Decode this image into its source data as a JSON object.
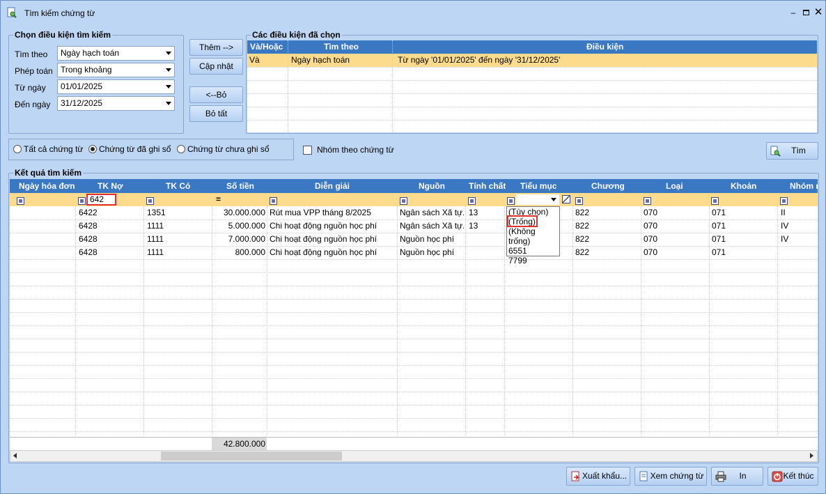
{
  "window": {
    "title": "Tìm kiếm chứng từ"
  },
  "conditions": {
    "legend": "Chọn điều kiện tìm kiếm",
    "search_by_label": "Tìm theo",
    "search_by_value": "Ngày hạch toán",
    "operator_label": "Phép toán",
    "operator_value": "Trong khoảng",
    "from_label": "Từ ngày",
    "from_value": "01/01/2025",
    "to_label": "Đến ngày",
    "to_value": "31/12/2025"
  },
  "buttons": {
    "add": "Thêm -->",
    "update": "Cập nhật",
    "remove": "<--Bỏ",
    "remove_all": "Bỏ tất",
    "search": "Tìm",
    "export": "Xuất khẩu...",
    "view": "Xem chứng từ",
    "print": "In",
    "close": "Kết thúc"
  },
  "selected": {
    "legend": "Các điều kiện đã chọn",
    "headers": [
      "Và/Hoặc",
      "Tìm theo",
      "Điều kiện"
    ],
    "row": [
      "Và",
      "Ngày hạch toán",
      "Từ ngày '01/01/2025' đến ngày '31/12/2025'"
    ]
  },
  "filters": {
    "all": "Tất cả chứng từ",
    "posted": "Chứng từ đã ghi sổ",
    "unposted": "Chứng từ chưa ghi sổ",
    "group_by": "Nhóm theo chứng từ"
  },
  "results": {
    "legend": "Kết quả tìm kiếm",
    "headers": [
      "Ngày hóa đơn",
      "TK Nợ",
      "TK Có",
      "Số tiền",
      "Diễn giải",
      "Nguồn",
      "Tính chất",
      "Tiểu mục",
      "Chương",
      "Loại",
      "Khoản",
      "Nhóm m"
    ],
    "filter_tk_no": "642",
    "filter_amount_op": "=",
    "rows": [
      [
        "",
        "6422",
        "1351",
        "30.000.000",
        "Rút mua VPP tháng 8/2025",
        "Ngân sách Xã tự...",
        "13",
        "",
        "822",
        "070",
        "071",
        "II"
      ],
      [
        "",
        "6428",
        "1111",
        "5.000.000",
        "Chi hoạt động nguồn học phí",
        "Ngân sách Xã tự...",
        "13",
        "",
        "822",
        "070",
        "071",
        "IV"
      ],
      [
        "",
        "6428",
        "1111",
        "7.000.000",
        "Chi hoạt động nguồn học phí",
        "Nguồn học phí",
        "",
        "",
        "822",
        "070",
        "071",
        "IV"
      ],
      [
        "",
        "6428",
        "1111",
        "800.000",
        "Chi hoạt động nguồn học phí",
        "Nguồn học phí",
        "",
        "",
        "822",
        "070",
        "071",
        ""
      ]
    ],
    "total": "42.800.000"
  },
  "dropdown": {
    "items": [
      "(Tùy chọn)",
      "(Trống)",
      "(Không trống)",
      "6551",
      "7799"
    ]
  }
}
